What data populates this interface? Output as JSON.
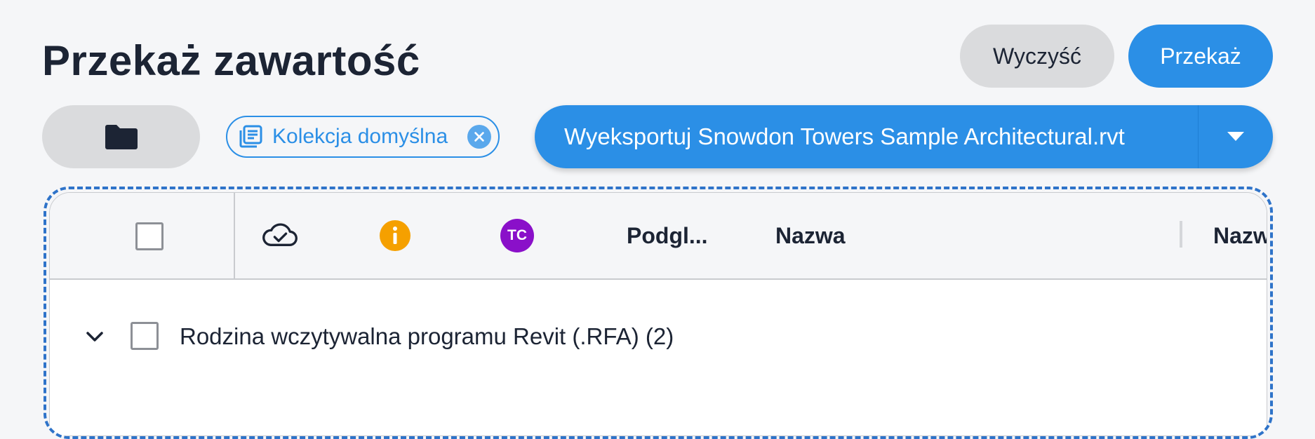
{
  "page": {
    "title": "Przekaż zawartość"
  },
  "toolbar": {
    "clear_label": "Wyczyść",
    "transfer_label": "Przekaż",
    "folder_icon": "folder-icon"
  },
  "collection_chip": {
    "label": "Kolekcja domyślna",
    "icon": "collection-icon",
    "close_icon": "close-icon"
  },
  "export_button": {
    "label": "Wyeksportuj Snowdon Towers Sample Architectural.rvt",
    "dropdown_icon": "caret-down-icon"
  },
  "table": {
    "columns": {
      "sync_icon": "cloud-check-icon",
      "info_icon": "info-icon",
      "tc_badge": "TC",
      "preview": "Podgl...",
      "name": "Nazwa",
      "name2": "Nazw"
    },
    "rows": [
      {
        "label": "Rodzina wczytywalna programu Revit (.RFA) (2)",
        "expanded": false
      }
    ]
  },
  "colors": {
    "accent": "#2b8fe6",
    "dashed_border": "#2e73c9",
    "info": "#f5a000",
    "tc_badge": "#8a10c9"
  }
}
